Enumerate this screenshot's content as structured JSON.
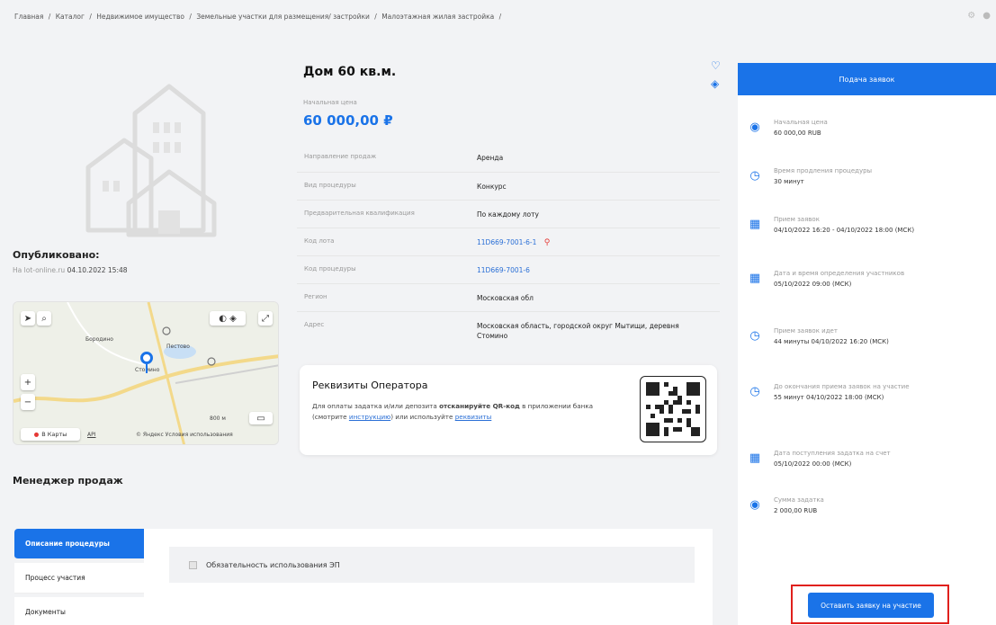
{
  "breadcrumb": [
    "Главная",
    "/",
    "Каталог",
    "/",
    "Недвижимое имущество",
    "/",
    "Земельные участки для размещения/ застройки",
    "/",
    "Малоэтажная жилая застройка",
    "/"
  ],
  "lot": {
    "title": "Дом 60 кв.м.",
    "start_price_label": "Начальная цена",
    "start_price": "60 000,00 ₽"
  },
  "published": {
    "label": "Опубликовано:",
    "source": "На lot-online.ru",
    "date": "04.10.2022 15:48"
  },
  "properties": [
    {
      "key": "Направление продаж",
      "value": "Аренда",
      "link": false
    },
    {
      "key": "Вид процедуры",
      "value": "Конкурс",
      "link": false
    },
    {
      "key": "Предварительная квалификация",
      "value": "По каждому лоту",
      "link": false
    },
    {
      "key": "Код лота",
      "value": "11D669-7001-6-1",
      "link": true
    },
    {
      "key": "Код процедуры",
      "value": "11D669-7001-6",
      "link": true
    },
    {
      "key": "Регион",
      "value": "Московская обл",
      "link": false
    },
    {
      "key": "Адрес",
      "value": "Московская область, городской округ Мытищи, деревня Стомино",
      "link": false
    }
  ],
  "map": {
    "labels": {
      "borodino": "Бородино",
      "stomino": "Стомино",
      "lake": "Пестово",
      "scale": "800 м",
      "yandex_maps": "В Карты",
      "api": "API",
      "yandex_terms": "© Яндекс Условия использования"
    }
  },
  "operator": {
    "title": "Реквизиты Оператора",
    "text_1": "Для оплаты задатка и/или депозита",
    "text_bold": "отсканируйте QR-код",
    "text_2": "в приложении банка (смотрите",
    "link_instruction": "инструкцию",
    "text_3": ") или используйте",
    "link_requisites": "реквизиты"
  },
  "manager_label": "Менеджер продаж",
  "tabs": [
    "Описание процедуры",
    "Процесс участия",
    "Документы"
  ],
  "esign_label": "Обязательность использования ЭП",
  "sidebar": {
    "header": "Подача заявок",
    "items": [
      {
        "icon": "money-icon",
        "label": "Начальная цена",
        "value": "60 000,00 RUB"
      },
      {
        "icon": "clock-icon",
        "label": "Время продления процедуры",
        "value": "30 минут"
      },
      {
        "icon": "calendar-icon",
        "label": "Прием заявок",
        "value": "04/10/2022 16:20 - 04/10/2022 18:00 (МСК)"
      },
      {
        "icon": "calendar-icon",
        "label": "Дата и время определения участников",
        "value": "05/10/2022 09:00 (МСК)"
      },
      {
        "icon": "clock-icon",
        "label": "Прием заявок идет",
        "value": "44 минуты 04/10/2022 16:20 (МСК)"
      },
      {
        "icon": "clock-icon",
        "label": "До окончания приема заявок на участие",
        "value": "55 минут 04/10/2022 18:00 (МСК)"
      },
      {
        "icon": "calendar-icon",
        "label": "Дата поступления задатка на счет",
        "value": "05/10/2022 00:00 (МСК)"
      },
      {
        "icon": "money-icon",
        "label": "Сумма задатка",
        "value": "2 000,00 RUB"
      }
    ],
    "apply_button": "Оставить заявку на участие"
  },
  "colors": {
    "accent": "#1a73e8",
    "highlight": "#e0201c"
  }
}
